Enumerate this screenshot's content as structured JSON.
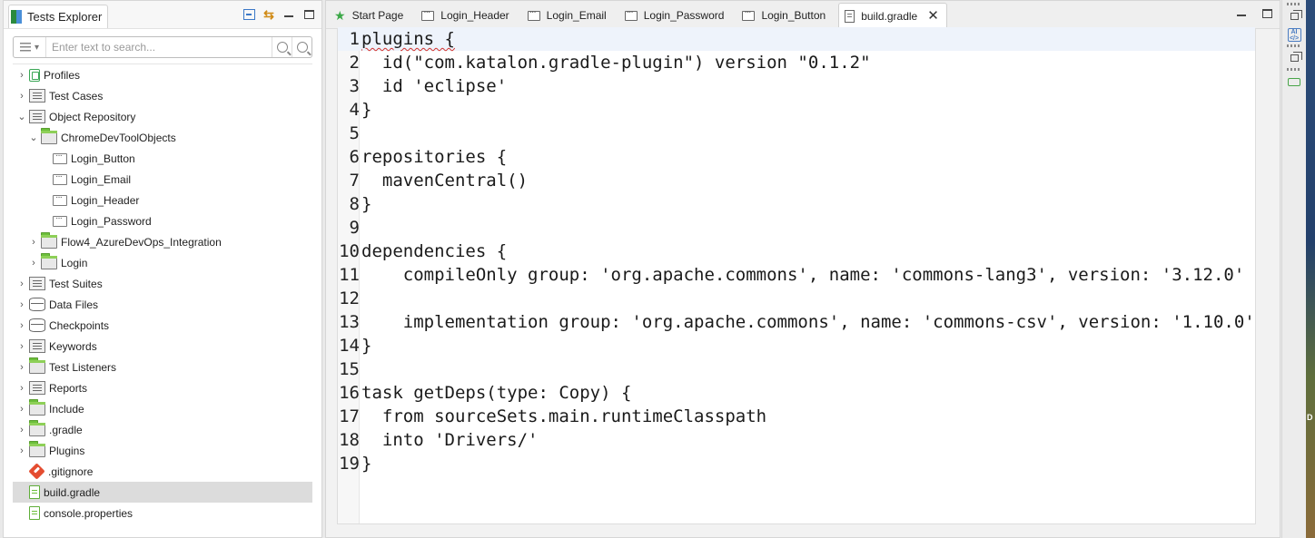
{
  "explorer": {
    "title": "Tests Explorer",
    "search_placeholder": "Enter text to search...",
    "tree": [
      {
        "label": "Profiles",
        "icon": "profile-icon",
        "chevron": "›"
      },
      {
        "label": "Test Cases",
        "icon": "test-cases-icon",
        "chevron": "›"
      },
      {
        "label": "Object Repository",
        "icon": "object-repository-icon",
        "chevron": "⌄"
      },
      {
        "label": "ChromeDevToolObjects",
        "icon": "folder-icon",
        "chevron": "⌄"
      },
      {
        "label": "Login_Button",
        "icon": "test-object-icon",
        "chevron": ""
      },
      {
        "label": "Login_Email",
        "icon": "test-object-icon",
        "chevron": ""
      },
      {
        "label": "Login_Header",
        "icon": "test-object-icon",
        "chevron": ""
      },
      {
        "label": "Login_Password",
        "icon": "test-object-icon",
        "chevron": ""
      },
      {
        "label": "Flow4_AzureDevOps_Integration",
        "icon": "folder-icon",
        "chevron": "›"
      },
      {
        "label": "Login",
        "icon": "folder-icon",
        "chevron": "›"
      },
      {
        "label": "Test Suites",
        "icon": "test-suites-icon",
        "chevron": "›"
      },
      {
        "label": "Data Files",
        "icon": "data-files-icon",
        "chevron": "›"
      },
      {
        "label": "Checkpoints",
        "icon": "checkpoints-icon",
        "chevron": "›"
      },
      {
        "label": "Keywords",
        "icon": "keywords-icon",
        "chevron": "›"
      },
      {
        "label": "Test Listeners",
        "icon": "folder-icon",
        "chevron": "›"
      },
      {
        "label": "Reports",
        "icon": "reports-icon",
        "chevron": "›"
      },
      {
        "label": "Include",
        "icon": "folder-icon",
        "chevron": "›"
      },
      {
        "label": ".gradle",
        "icon": "folder-icon",
        "chevron": "›"
      },
      {
        "label": "Plugins",
        "icon": "folder-icon",
        "chevron": "›"
      },
      {
        "label": ".gitignore",
        "icon": "git-icon",
        "chevron": ""
      },
      {
        "label": "build.gradle",
        "icon": "file-icon",
        "chevron": "",
        "selected": true
      },
      {
        "label": "console.properties",
        "icon": "file-icon",
        "chevron": ""
      }
    ]
  },
  "editor": {
    "tabs": [
      {
        "label": "Start Page",
        "icon": "star-icon"
      },
      {
        "label": "Login_Header",
        "icon": "test-object-icon"
      },
      {
        "label": "Login_Email",
        "icon": "test-object-icon"
      },
      {
        "label": "Login_Password",
        "icon": "test-object-icon"
      },
      {
        "label": "Login_Button",
        "icon": "test-object-icon"
      },
      {
        "label": "build.gradle",
        "icon": "document-icon",
        "active": true
      }
    ],
    "lines": [
      {
        "n": "1",
        "text": "plugins {"
      },
      {
        "n": "2",
        "text": "  id(\"com.katalon.gradle-plugin\") version \"0.1.2\""
      },
      {
        "n": "3",
        "text": "  id 'eclipse'"
      },
      {
        "n": "4",
        "text": "}"
      },
      {
        "n": "5",
        "text": ""
      },
      {
        "n": "6",
        "text": "repositories {"
      },
      {
        "n": "7",
        "text": "  mavenCentral()"
      },
      {
        "n": "8",
        "text": "}"
      },
      {
        "n": "9",
        "text": ""
      },
      {
        "n": "10",
        "text": "dependencies {"
      },
      {
        "n": "11",
        "text": "    compileOnly group: 'org.apache.commons', name: 'commons-lang3', version: '3.12.0'"
      },
      {
        "n": "12",
        "text": ""
      },
      {
        "n": "13",
        "text": "    implementation group: 'org.apache.commons', name: 'commons-csv', version: '1.10.0'"
      },
      {
        "n": "14",
        "text": "}"
      },
      {
        "n": "15",
        "text": ""
      },
      {
        "n": "16",
        "text": "task getDeps(type: Copy) {"
      },
      {
        "n": "17",
        "text": "  from sourceSets.main.runtimeClasspath"
      },
      {
        "n": "18",
        "text": "  into 'Drivers/'"
      },
      {
        "n": "19",
        "text": "}"
      }
    ]
  },
  "colors": {
    "accent_green": "#3ca848",
    "selection": "#dcdcdc",
    "error_squiggle": "#d0312d"
  }
}
